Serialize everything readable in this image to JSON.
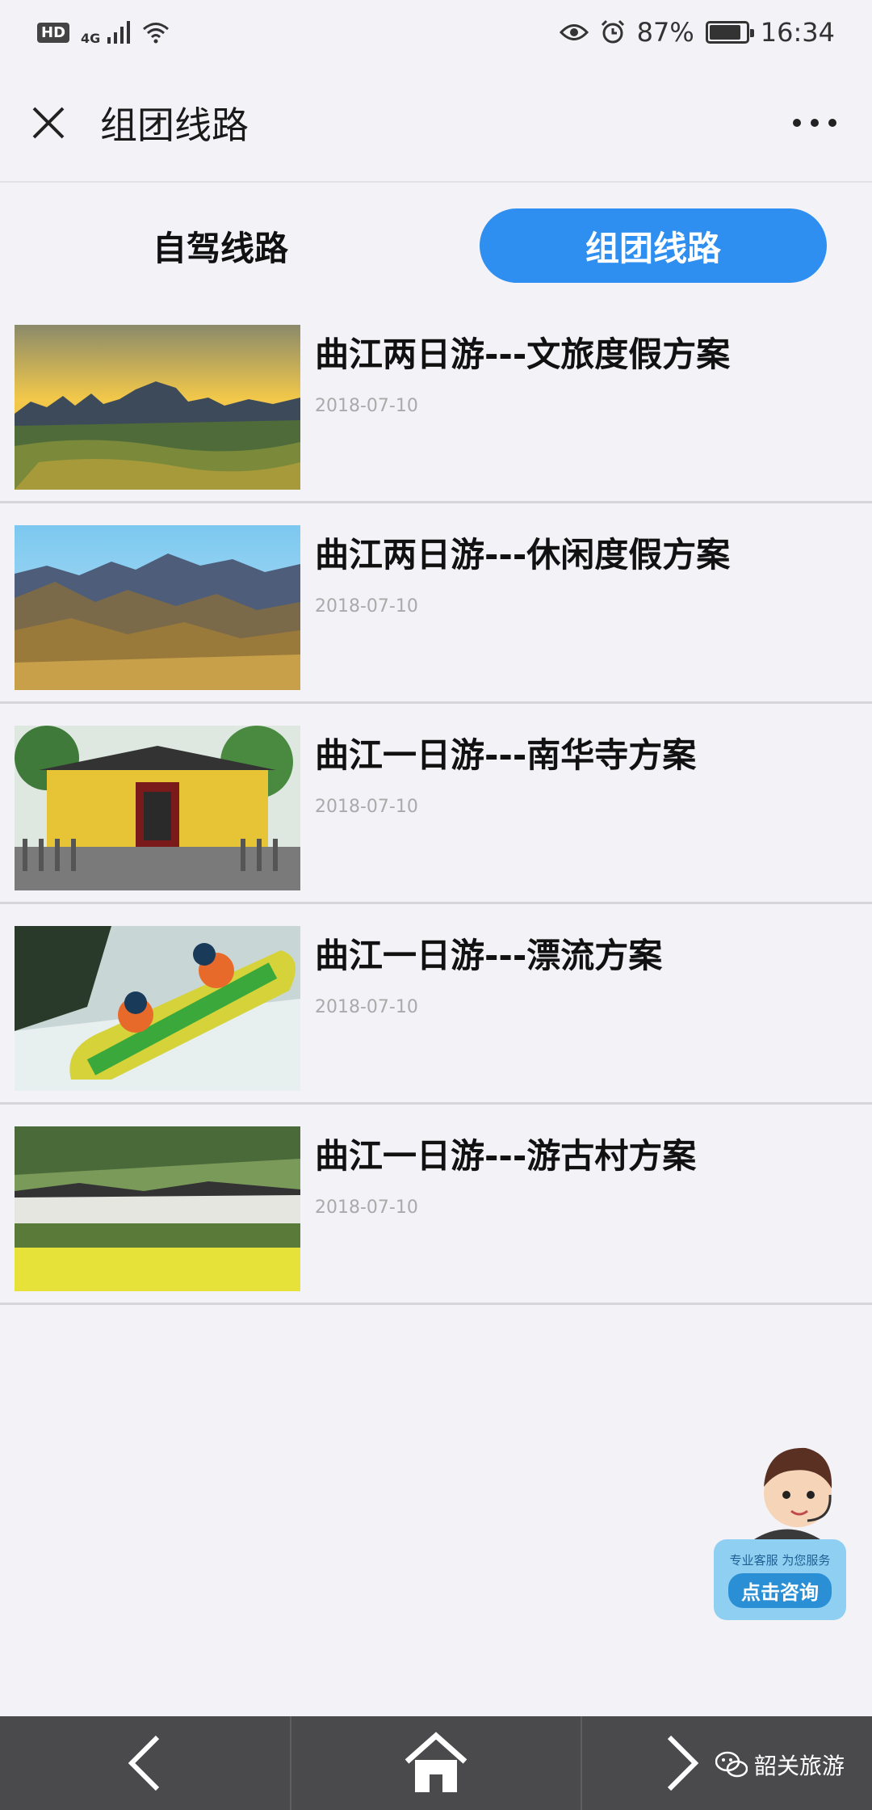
{
  "status_bar": {
    "hd": "HD",
    "network": "4G",
    "battery": "87%",
    "battery_level": 0.87,
    "time": "16:34"
  },
  "header": {
    "title": "组团线路"
  },
  "tabs": [
    {
      "label": "自驾线路",
      "active": false
    },
    {
      "label": "组团线路",
      "active": true
    }
  ],
  "routes": [
    {
      "title": "曲江两日游---文旅度假方案",
      "date": "2018-07-10",
      "image": "karst-landscape-photo"
    },
    {
      "title": "曲江两日游---休闲度假方案",
      "date": "2018-07-10",
      "image": "mountain-range-photo"
    },
    {
      "title": "曲江一日游---南华寺方案",
      "date": "2018-07-10",
      "image": "temple-photo"
    },
    {
      "title": "曲江一日游---漂流方案",
      "date": "2018-07-10",
      "image": "rafting-photo"
    },
    {
      "title": "曲江一日游---游古村方案",
      "date": "2018-07-10",
      "image": "village-photo"
    }
  ],
  "consult": {
    "subtitle": "专业客服 为您服务",
    "label": "点击咨询"
  },
  "watermark": "韶关旅游",
  "colors": {
    "accent": "#2e8ff0",
    "background": "#f3f2f7",
    "nav_bg": "#4a4a4c"
  }
}
